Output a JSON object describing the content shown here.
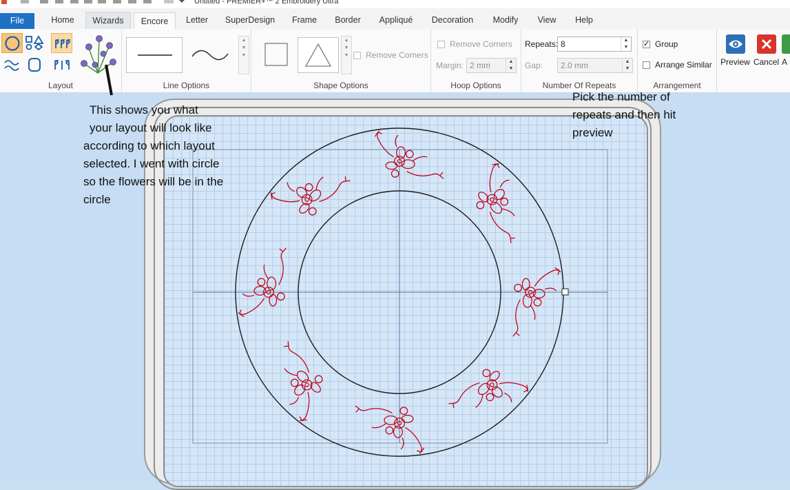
{
  "window": {
    "title": "Untitled - PREMIER+™ 2 Embroidery Ultra"
  },
  "tabs": [
    {
      "label": "File"
    },
    {
      "label": "Home"
    },
    {
      "label": "Wizards"
    },
    {
      "label": "Encore"
    },
    {
      "label": "Letter"
    },
    {
      "label": "SuperDesign"
    },
    {
      "label": "Frame"
    },
    {
      "label": "Border"
    },
    {
      "label": "Appliqué"
    },
    {
      "label": "Decoration"
    },
    {
      "label": "Modify"
    },
    {
      "label": "View"
    },
    {
      "label": "Help"
    }
  ],
  "ribbon": {
    "layout": {
      "label": "Layout"
    },
    "line_options": {
      "label": "Line Options"
    },
    "shape_options": {
      "label": "Shape Options",
      "remove_corners": "Remove Corners"
    },
    "hoop_options": {
      "label": "Hoop Options",
      "remove_corners": "Remove Corners",
      "margin_label": "Margin:",
      "margin_value": "2 mm"
    },
    "repeats": {
      "label": "Number Of Repeats",
      "repeats_label": "Repeats:",
      "repeats_value": "8",
      "gap_label": "Gap:",
      "gap_value": "2.0 mm"
    },
    "arrangement": {
      "label": "Arrangement",
      "group": "Group",
      "arrange_similar": "Arrange Similar"
    },
    "actions": {
      "preview": "Preview",
      "cancel": "Cancel",
      "apply": "A"
    }
  },
  "annotations": {
    "left_note": [
      "This shows you what",
      "your layout will look like",
      "according to which layout",
      "selected.  I went with circle",
      "so the flowers will be in the",
      "circle"
    ],
    "right_note": [
      "Pick the number of",
      "repeats and then hit",
      "preview"
    ]
  },
  "design": {
    "repeats": 8,
    "thread_color": "#c00016",
    "guide_color": "#222222"
  },
  "colors": {
    "file_tab": "#1e6fc6",
    "selected_button": "#f9c37a",
    "canvas_bg": "#c6ddf3",
    "preview_icon": "#2e6fb5",
    "cancel_icon": "#d9342b"
  }
}
